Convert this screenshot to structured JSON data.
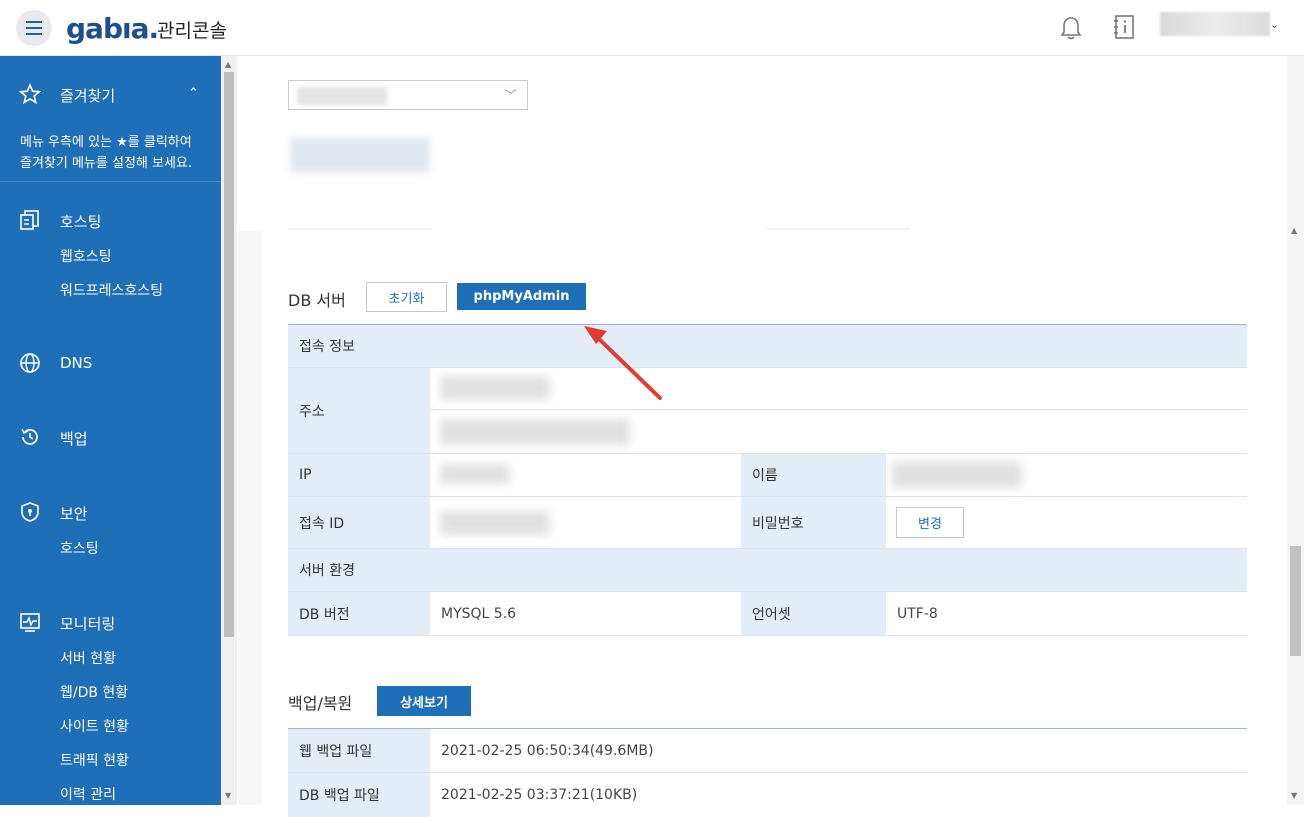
{
  "header": {
    "logo": "gabıa.",
    "app_title": "관리콘솔",
    "user_caret": "⌄"
  },
  "sidebar": {
    "favorites_title": "즐겨찾기",
    "favorites_caret": "⌃",
    "favorites_desc_line1": "메뉴 우측에 있는 ★를 클릭하여",
    "favorites_desc_line2": "즐겨찾기 메뉴를 설정해 보세요.",
    "hosting": "호스팅",
    "hosting_items": [
      "웹호스팅",
      "워드프레스호스팅"
    ],
    "dns": "DNS",
    "backup": "백업",
    "security": "보안",
    "security_items": [
      "호스팅"
    ],
    "monitoring": "모니터링",
    "monitoring_items": [
      "서버 현황",
      "웹/DB 현황",
      "사이트 현황",
      "트래픽 현황",
      "이력 관리"
    ]
  },
  "db_server": {
    "title": "DB 서버",
    "reset_button": "초기화",
    "phpmyadmin_button": "phpMyAdmin",
    "conn_info_header": "접속 정보",
    "address_label": "주소",
    "ip_label": "IP",
    "name_label": "이름",
    "conn_id_label": "접속 ID",
    "password_label": "비밀번호",
    "change_button": "변경",
    "server_env_header": "서버 환경",
    "db_version_label": "DB 버전",
    "db_version_value": "MYSQL 5.6",
    "charset_label": "언어셋",
    "charset_value": "UTF-8"
  },
  "backup": {
    "title": "백업/복원",
    "detail_button": "상세보기",
    "web_backup_label": "웹 백업 파일",
    "web_backup_value": "2021-02-25 06:50:34(49.6MB)",
    "db_backup_label": "DB 백업 파일",
    "db_backup_value": "2021-02-25 03:37:21(10KB)"
  },
  "colors": {
    "sidebar_bg": "#1e6fb8",
    "primary": "#1e6fb8",
    "table_header_bg": "#e4edf7",
    "annotation_arrow": "#e03c31"
  }
}
